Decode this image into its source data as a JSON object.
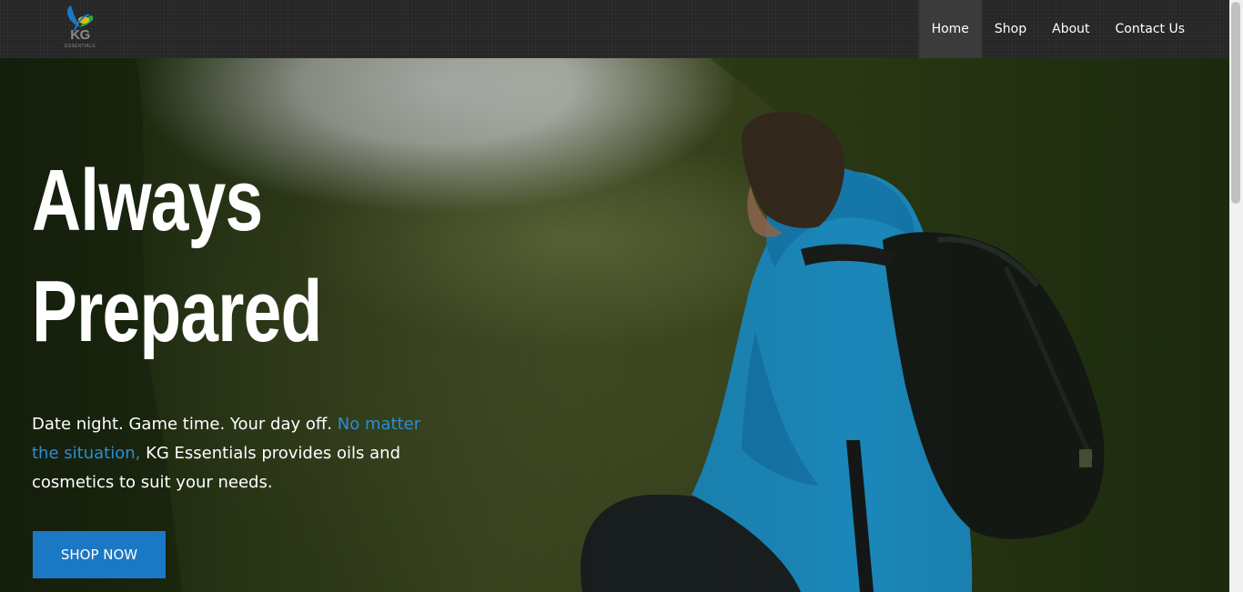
{
  "navbar": {
    "logo_text": "KG",
    "logo_sub": "ESSENTIALS",
    "items": [
      {
        "label": "Home",
        "active": true
      },
      {
        "label": "Shop",
        "active": false
      },
      {
        "label": "About",
        "active": false
      },
      {
        "label": "Contact Us",
        "active": false
      }
    ]
  },
  "hero": {
    "title_line1": "Always",
    "title_line2": "Prepared",
    "text_part1": "Date night. Game time. Your day off. ",
    "text_accent": "No matter the situation,",
    "text_part2": " KG Essentials provides oils and cosmetics to suit your needs.",
    "button_label": "SHOP NOW"
  },
  "colors": {
    "accent": "#2a8fd4",
    "button": "#1b78c4",
    "navbar": "#262626"
  }
}
